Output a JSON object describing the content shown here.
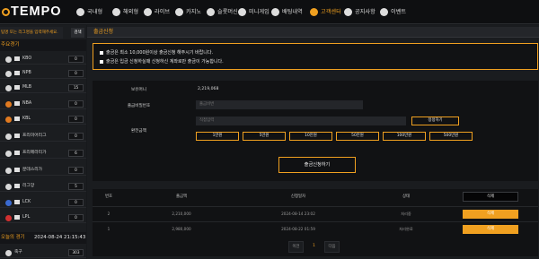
{
  "header": {
    "logo": "TEMPO",
    "nav": [
      {
        "label": "국내형",
        "icon": "soccer-icon"
      },
      {
        "label": "해외형",
        "icon": "globe-icon"
      },
      {
        "label": "라이브",
        "icon": "live-icon"
      },
      {
        "label": "카지노",
        "icon": "casino-icon"
      },
      {
        "label": "슬롯머신",
        "icon": "slot-icon"
      },
      {
        "label": "미니게임",
        "icon": "minigame-icon"
      },
      {
        "label": "배팅내역",
        "icon": "history-icon"
      },
      {
        "label": "고객센터",
        "icon": "support-icon"
      },
      {
        "label": "공지사항",
        "icon": "notice-icon"
      },
      {
        "label": "이벤트",
        "icon": "event-icon"
      }
    ]
  },
  "sidebar": {
    "search_placeholder": "팀명 또는 리그명을 입력해주세요.",
    "search_button": "검색",
    "section_title": "주요경기",
    "sports": [
      {
        "label": "KBO",
        "count": "0",
        "color": "#d8d8d8"
      },
      {
        "label": "NPB",
        "count": "0",
        "color": "#d8d8d8"
      },
      {
        "label": "MLB",
        "count": "15",
        "color": "#d8d8d8"
      },
      {
        "label": "NBA",
        "count": "0",
        "color": "#e07a20"
      },
      {
        "label": "KBL",
        "count": "0",
        "color": "#e07a20"
      },
      {
        "label": "프리미어리그",
        "count": "0",
        "color": "#d8d8d8"
      },
      {
        "label": "프리메라리가",
        "count": "6",
        "color": "#d8d8d8"
      },
      {
        "label": "분데스리가",
        "count": "0",
        "color": "#d8d8d8"
      },
      {
        "label": "리그앙",
        "count": "5",
        "color": "#d8d8d8"
      },
      {
        "label": "LCK",
        "count": "0",
        "color": "#3a6ad0"
      },
      {
        "label": "LPL",
        "count": "0",
        "color": "#d03030"
      }
    ],
    "today_title": "오늘의 경기",
    "today_time": "2024-08-24 21:15:43",
    "today_rows": [
      {
        "label": "축구",
        "count": "303"
      }
    ]
  },
  "page": {
    "title": "출금신청",
    "notices": [
      "출금은 최소 10,000원이상 출금신청 해주시기 바랍니다.",
      "출금은 입금 신청하실때 신청하신 계좌로만 출금이 가능합니다."
    ],
    "form": {
      "balance_label": "보유머니",
      "balance_value": "2,219,068",
      "password_label": "출금비밀번호",
      "password_placeholder": "출금비번",
      "amount_label": "환전금액",
      "amount_placeholder": "직접입력",
      "reset_button": "정정하기",
      "quick_amounts": [
        "1만원",
        "5만원",
        "10만원",
        "50만원",
        "100만원",
        "500만원"
      ],
      "submit_button": "출금신청하기"
    },
    "table": {
      "headers": [
        "번호",
        "출금액",
        "신청일자",
        "상태"
      ],
      "delete_all": "삭제",
      "rows": [
        {
          "no": "2",
          "amount": "2,210,000",
          "date": "2024-08-14 23:02",
          "status": "처리중",
          "delete": "삭제"
        },
        {
          "no": "1",
          "amount": "2,980,000",
          "date": "2024-08-22 01:59",
          "status": "처리완료",
          "delete": "삭제"
        }
      ]
    },
    "pager": {
      "prev": "이전",
      "current": "1",
      "next": "다음"
    }
  },
  "colors": {
    "accent": "#f0a020",
    "background": "#17191c",
    "panel": "#111214"
  }
}
